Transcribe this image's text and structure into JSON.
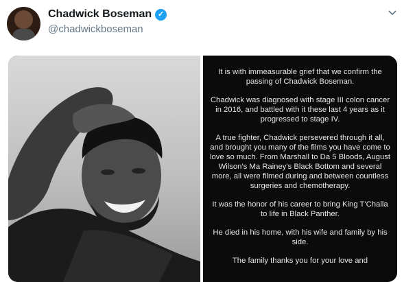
{
  "tweet": {
    "display_name": "Chadwick Boseman",
    "handle": "@chadwickboseman",
    "verified_icon": "verified-badge-icon",
    "menu_icon": "chevron-down-icon"
  },
  "statement": {
    "paragraphs": [
      "It is with immeasurable grief that we confirm the passing of Chadwick Boseman.",
      "Chadwick was diagnosed with stage III colon cancer in 2016, and battled with it these last 4 years as it progressed to stage IV.",
      "A true fighter, Chadwick persevered through it all, and brought you many of the films you have come to love so much. From Marshall to Da 5 Bloods, August Wilson's Ma Rainey's Black Bottom and several more, all were filmed during and between countless surgeries and chemotherapy.",
      "It was the honor of his career to bring King T'Challa to life in Black Panther.",
      "He died in his home, with his wife and family by his side.",
      "The family thanks you for your love and"
    ]
  },
  "colors": {
    "verified_blue": "#1da1f2",
    "secondary_text": "#657786",
    "statement_background": "#0b0b0b"
  }
}
